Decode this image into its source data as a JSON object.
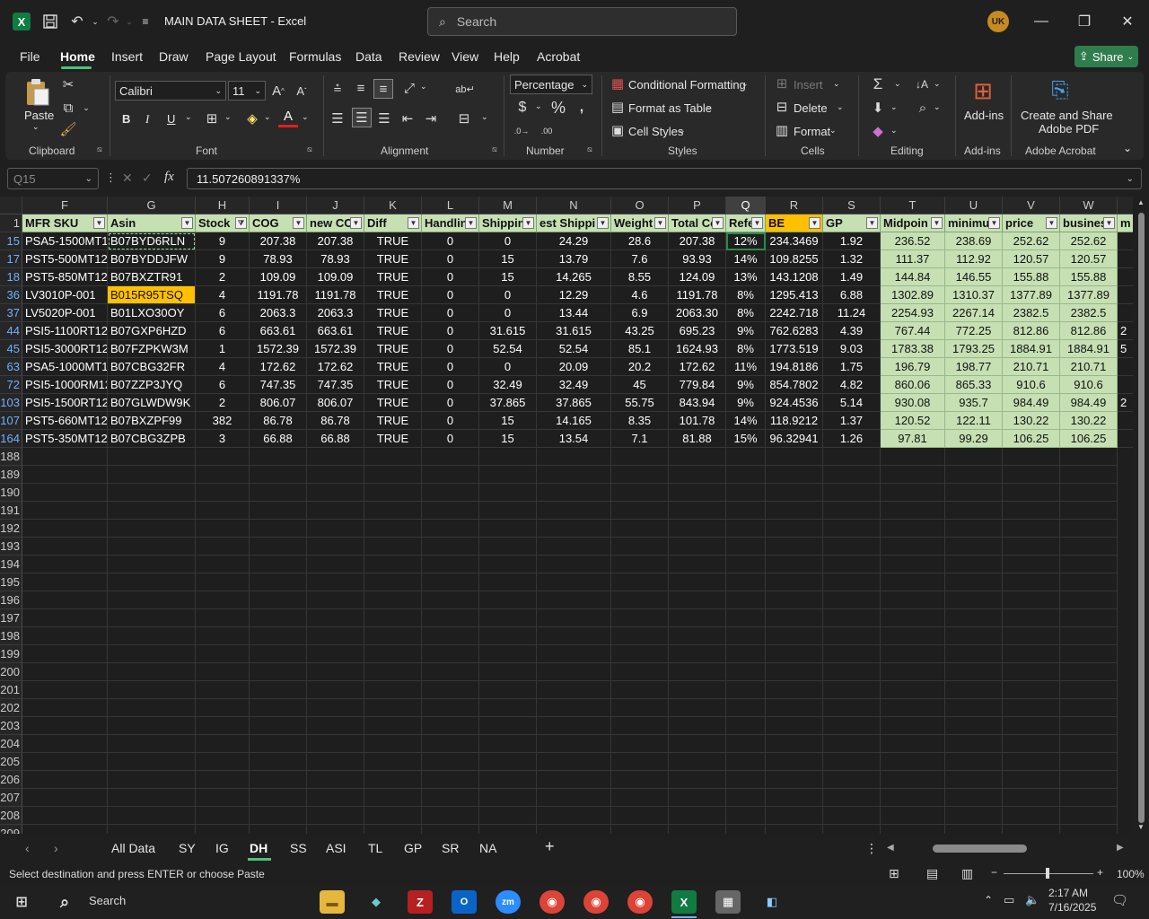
{
  "titlebar": {
    "title": "MAIN DATA SHEET  -  Excel",
    "search_placeholder": "Search",
    "user_initials": "UK",
    "app_icon": "X"
  },
  "menu": {
    "items": [
      "File",
      "Home",
      "Insert",
      "Draw",
      "Page Layout",
      "Formulas",
      "Data",
      "Review",
      "View",
      "Help",
      "Acrobat"
    ],
    "share": "Share"
  },
  "ribbon": {
    "paste": "Paste",
    "clipboard": "Clipboard",
    "font_name": "Calibri",
    "font_size": "11",
    "font": "Font",
    "alignment": "Alignment",
    "number_format": "Percentage",
    "number": "Number",
    "conditional_formatting": "Conditional Formatting",
    "format_as_table": "Format as Table",
    "cell_styles": "Cell Styles",
    "styles": "Styles",
    "insert": "Insert",
    "delete": "Delete",
    "format": "Format",
    "cells": "Cells",
    "editing": "Editing",
    "addins_btn": "Add-ins",
    "addins": "Add-ins",
    "create_share_1": "Create and Share",
    "create_share_2": "Adobe PDF",
    "adobe_acrobat": "Adobe Acrobat",
    "bold": "B",
    "italic": "I",
    "underline": "U"
  },
  "formula": {
    "name_box": "Q15",
    "fx": "fx",
    "value": "11.507260891337%"
  },
  "grid": {
    "columns": [
      "F",
      "G",
      "H",
      "I",
      "J",
      "K",
      "L",
      "M",
      "N",
      "O",
      "P",
      "Q",
      "R",
      "S",
      "T",
      "U",
      "V",
      "W"
    ],
    "headers": [
      "MFR SKU",
      "Asin",
      "Stock",
      "COG",
      "new CO",
      "Diff",
      "Handlin",
      "Shippin",
      "est Shippi",
      "Weight",
      "Total Co",
      "Refe",
      "BE",
      "GP",
      "Midpoin",
      "minimu",
      "price",
      "busines"
    ],
    "extra_header": "m",
    "data_rows": [
      {
        "num": "15",
        "cells": [
          "PSA5-1500MT11",
          "B07BYD6RLN",
          "9",
          "207.38",
          "207.38",
          "TRUE",
          "0",
          "0",
          "24.29",
          "28.6",
          "207.38",
          "12%",
          "234.3469",
          "1.92",
          "236.52",
          "238.69",
          "252.62",
          "252.62"
        ]
      },
      {
        "num": "17",
        "cells": [
          "PST5-500MT120",
          "B07BYDDJFW",
          "9",
          "78.93",
          "78.93",
          "TRUE",
          "0",
          "15",
          "13.79",
          "7.6",
          "93.93",
          "14%",
          "109.8255",
          "1.32",
          "111.37",
          "112.92",
          "120.57",
          "120.57"
        ]
      },
      {
        "num": "18",
        "cells": [
          "PST5-850MT120",
          "B07BXZTR91",
          "2",
          "109.09",
          "109.09",
          "TRUE",
          "0",
          "15",
          "14.265",
          "8.55",
          "124.09",
          "13%",
          "143.1208",
          "1.49",
          "144.84",
          "146.55",
          "155.88",
          "155.88"
        ]
      },
      {
        "num": "36",
        "cells": [
          "LV3010P-001",
          "B015R95TSQ",
          "4",
          "1191.78",
          "1191.78",
          "TRUE",
          "0",
          "0",
          "12.29",
          "4.6",
          "1191.78",
          "8%",
          "1295.413",
          "6.88",
          "1302.89",
          "1310.37",
          "1377.89",
          "1377.89"
        ]
      },
      {
        "num": "37",
        "cells": [
          "LV5020P-001",
          "B01LXO30OY",
          "6",
          "2063.3",
          "2063.3",
          "TRUE",
          "0",
          "0",
          "13.44",
          "6.9",
          "2063.30",
          "8%",
          "2242.718",
          "11.24",
          "2254.93",
          "2267.14",
          "2382.5",
          "2382.5"
        ]
      },
      {
        "num": "44",
        "cells": [
          "PSI5-1100RT120",
          "B07GXP6HZD",
          "6",
          "663.61",
          "663.61",
          "TRUE",
          "0",
          "31.615",
          "31.615",
          "43.25",
          "695.23",
          "9%",
          "762.6283",
          "4.39",
          "767.44",
          "772.25",
          "812.86",
          "812.86"
        ]
      },
      {
        "num": "45",
        "cells": [
          "PSI5-3000RT120",
          "B07FZPKW3M",
          "1",
          "1572.39",
          "1572.39",
          "TRUE",
          "0",
          "52.54",
          "52.54",
          "85.1",
          "1624.93",
          "8%",
          "1773.519",
          "9.03",
          "1783.38",
          "1793.25",
          "1884.91",
          "1884.91"
        ]
      },
      {
        "num": "63",
        "cells": [
          "PSA5-1000MT11",
          "B07CBG32FR",
          "4",
          "172.62",
          "172.62",
          "TRUE",
          "0",
          "0",
          "20.09",
          "20.2",
          "172.62",
          "11%",
          "194.8186",
          "1.75",
          "196.79",
          "198.77",
          "210.71",
          "210.71"
        ]
      },
      {
        "num": "72",
        "cells": [
          "PSI5-1000RM12",
          "B07ZZP3JYQ",
          "6",
          "747.35",
          "747.35",
          "TRUE",
          "0",
          "32.49",
          "32.49",
          "45",
          "779.84",
          "9%",
          "854.7802",
          "4.82",
          "860.06",
          "865.33",
          "910.6",
          "910.6"
        ]
      },
      {
        "num": "103",
        "cells": [
          "PSI5-1500RT120",
          "B07GLWDW9K",
          "2",
          "806.07",
          "806.07",
          "TRUE",
          "0",
          "37.865",
          "37.865",
          "55.75",
          "843.94",
          "9%",
          "924.4536",
          "5.14",
          "930.08",
          "935.7",
          "984.49",
          "984.49"
        ]
      },
      {
        "num": "107",
        "cells": [
          "PST5-660MT120",
          "B07BXZPF99",
          "382",
          "86.78",
          "86.78",
          "TRUE",
          "0",
          "15",
          "14.165",
          "8.35",
          "101.78",
          "14%",
          "118.9212",
          "1.37",
          "120.52",
          "122.11",
          "130.22",
          "130.22"
        ]
      },
      {
        "num": "164",
        "cells": [
          "PST5-350MT120",
          "B07CBG3ZPB",
          "3",
          "66.88",
          "66.88",
          "TRUE",
          "0",
          "15",
          "13.54",
          "7.1",
          "81.88",
          "15%",
          "96.32941",
          "1.26",
          "97.81",
          "99.29",
          "106.25",
          "106.25"
        ]
      }
    ],
    "overflow_chars": {
      "44": "2",
      "45": "5",
      "103": "2"
    },
    "empty_rows": [
      "188",
      "189",
      "190",
      "191",
      "192",
      "193",
      "194",
      "195",
      "196",
      "197",
      "198",
      "199",
      "200",
      "201",
      "202",
      "203",
      "204",
      "205",
      "206",
      "207",
      "208",
      "209"
    ]
  },
  "tabs": {
    "items": [
      "All Data",
      "SY",
      "IG",
      "DH",
      "SS",
      "ASI",
      "TL",
      "GP",
      "SR",
      "NA"
    ],
    "active": "DH"
  },
  "status": {
    "text": "Select destination and press ENTER or choose Paste",
    "zoom": "100%"
  },
  "taskbar": {
    "search": "Search",
    "time": "2:17 AM",
    "date": "7/16/2025"
  },
  "colors": {
    "accent": "#107c41",
    "header_green": "#c6e0b4",
    "highlight": "#ffc000",
    "share": "#2f7d4c"
  }
}
